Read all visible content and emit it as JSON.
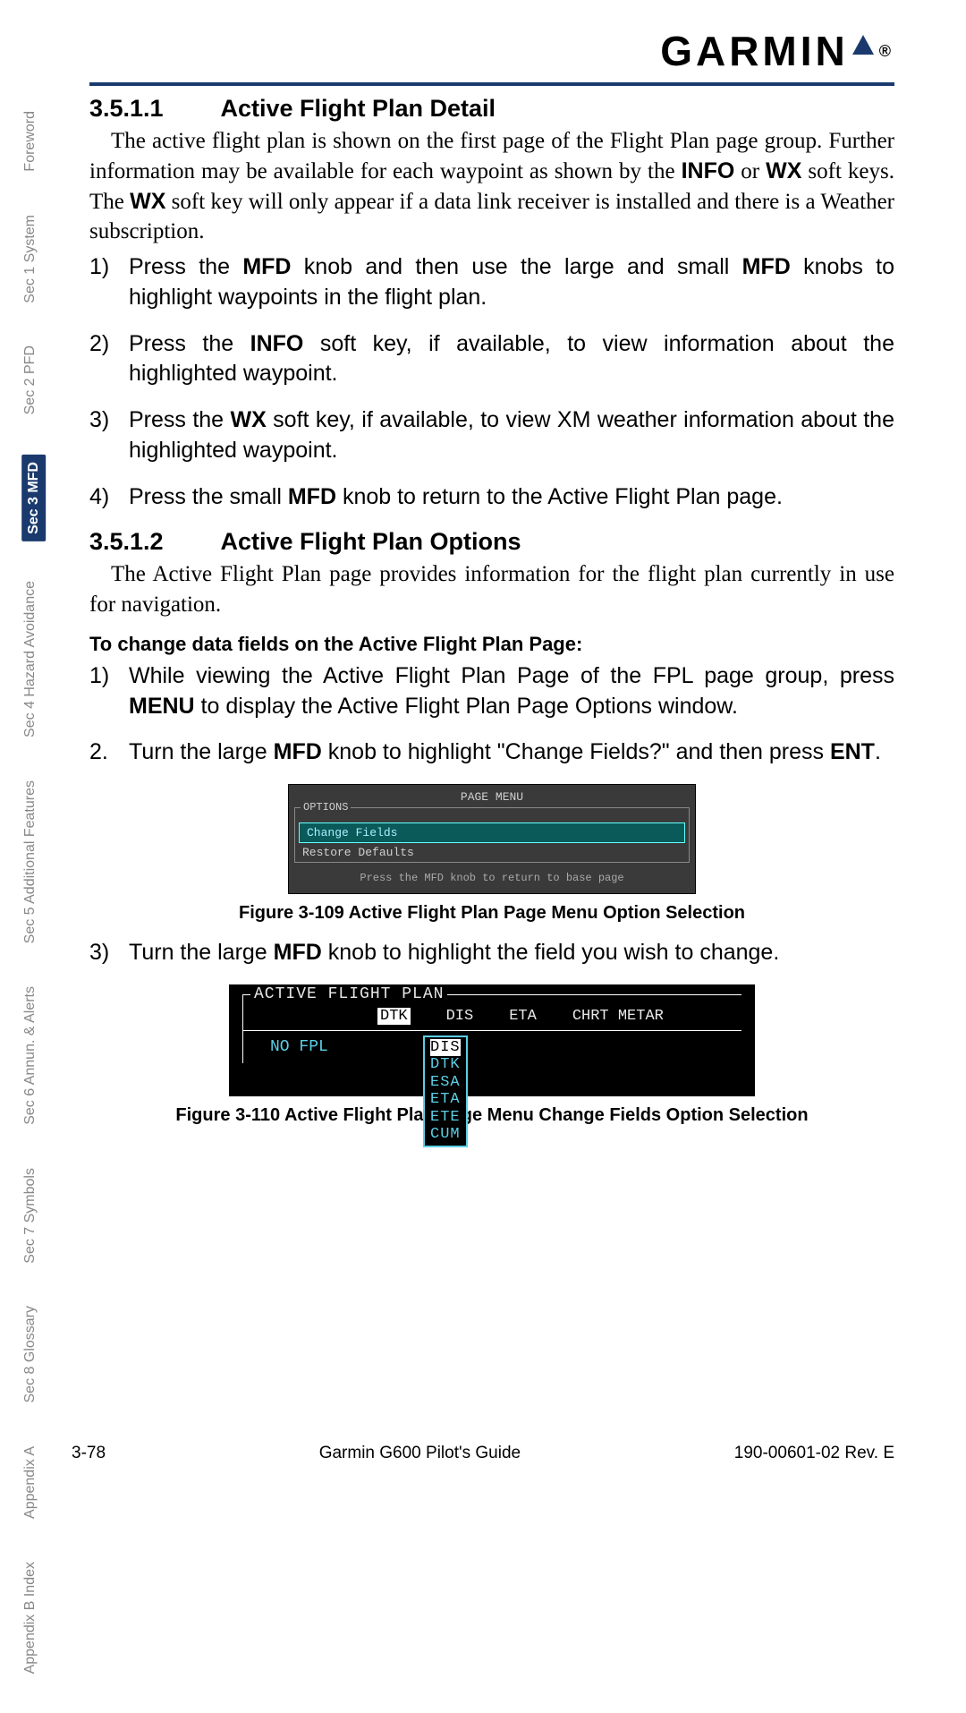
{
  "brand": "GARMIN",
  "side_tabs": [
    {
      "label": "Foreword",
      "active": false
    },
    {
      "label": "Sec 1\nSystem",
      "active": false
    },
    {
      "label": "Sec 2\nPFD",
      "active": false
    },
    {
      "label": "Sec 3\nMFD",
      "active": true
    },
    {
      "label": "Sec 4\nHazard\nAvoidance",
      "active": false
    },
    {
      "label": "Sec 5\nAdditional\nFeatures",
      "active": false
    },
    {
      "label": "Sec 6\nAnnun.\n& Alerts",
      "active": false
    },
    {
      "label": "Sec 7\nSymbols",
      "active": false
    },
    {
      "label": "Sec 8\nGlossary",
      "active": false
    },
    {
      "label": "Appendix A",
      "active": false
    },
    {
      "label": "Appendix B\nIndex",
      "active": false
    }
  ],
  "s1": {
    "num": "3.5.1.1",
    "title": "Active Flight Plan Detail",
    "p1a": "The active flight plan is shown on the first page of the Flight Plan page group. Further information may be available for each waypoint as shown by the ",
    "p1b": " or ",
    "p1c": " soft keys. The ",
    "p1d": " soft key will only appear if a data link receiver is installed and there is a Weather subscription.",
    "k_info": "INFO",
    "k_wx": "WX",
    "steps": [
      {
        "n": "1)",
        "a": "Press the ",
        "b": "MFD",
        "c": " knob and then use the large and small ",
        "d": "MFD",
        "e": " knobs to highlight waypoints in the flight plan."
      },
      {
        "n": "2)",
        "a": "Press the ",
        "b": "INFO",
        "c": " soft key, if available, to view information about the highlighted waypoint.",
        "d": "",
        "e": ""
      },
      {
        "n": "3)",
        "a": "Press the ",
        "b": "WX",
        "c": " soft key, if available, to view XM weather information about the highlighted waypoint.",
        "d": "",
        "e": ""
      },
      {
        "n": "4)",
        "a": "Press the small ",
        "b": "MFD",
        "c": " knob to return to the Active Flight Plan page.",
        "d": "",
        "e": ""
      }
    ]
  },
  "s2": {
    "num": "3.5.1.2",
    "title": "Active Flight Plan Options",
    "p1": "The Active Flight Plan page provides information for the flight plan currently in use for navigation.",
    "h4": "To change data fields on the Active Flight Plan Page:",
    "st1": {
      "n": "1)",
      "a": "While viewing the Active Flight Plan Page of the FPL page group, press ",
      "b": "MENU",
      "c": " to display the Active Flight Plan Page Options window."
    },
    "st2": {
      "n": "2.",
      "a": "Turn the large ",
      "b": "MFD",
      "c": " knob to highlight \"Change Fields?\" and then press ",
      "d": "ENT",
      "e": "."
    },
    "st3": {
      "n": "3)",
      "a": "Turn the large ",
      "b": "MFD",
      "c": " knob to highlight the field you wish to change."
    }
  },
  "fig109": {
    "menu_title": "PAGE MENU",
    "box_label": "OPTIONS",
    "opt1": "Change Fields",
    "opt2": "Restore Defaults",
    "hint": "Press the MFD knob to return to base page",
    "caption": "Figure 3-109  Active Flight Plan Page Menu Option Selection"
  },
  "fig110": {
    "frame_label": "ACTIVE FLIGHT PLAN",
    "cols": {
      "c1": "DTK",
      "c2": "DIS",
      "c3": "ETA",
      "c4": "CHRT METAR"
    },
    "nofpl": "NO FPL",
    "dropdown": [
      "DIS",
      "DTK",
      "ESA",
      "ETA",
      "ETE",
      "CUM"
    ],
    "selected": "DIS",
    "caption": "Figure 3-110  Active Flight Plan Page Menu Change Fields Option Selection"
  },
  "footer": {
    "page": "3-78",
    "title": "Garmin G600 Pilot's Guide",
    "doc": "190-00601-02  Rev. E"
  }
}
